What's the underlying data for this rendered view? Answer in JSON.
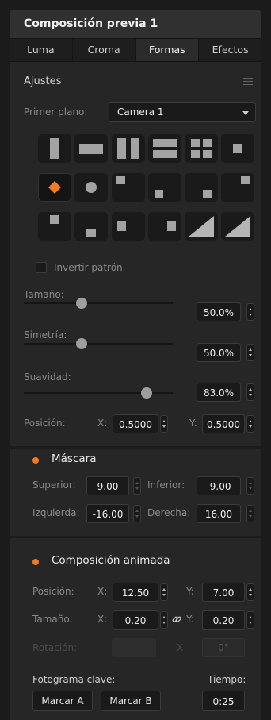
{
  "panel_title": "Composición previa 1",
  "tabs": [
    {
      "label": "Luma"
    },
    {
      "label": "Croma"
    },
    {
      "label": "Formas"
    },
    {
      "label": "Efectos"
    }
  ],
  "active_tab": "Formas",
  "settings": {
    "title": "Ajustes",
    "foreground_label": "Primer plano:",
    "foreground_value": "Camera 1",
    "invert_label": "Invertir patrón",
    "invert_checked": false,
    "size_label": "Tamaño:",
    "size_value": "50.0%",
    "size_level": 0.5,
    "symmetry_label": "Simetría:",
    "symmetry_value": "50.0%",
    "symmetry_level": 0.5,
    "softness_label": "Suavidad:",
    "softness_value": "83.0%",
    "softness_level": 0.83,
    "position_label": "Posición:",
    "pos_x_label": "X:",
    "pos_x_value": "0.5000",
    "pos_y_label": "Y:",
    "pos_y_value": "0.5000"
  },
  "shape_buttons": [
    "vertical-bar-icon",
    "horizontal-bar-icon",
    "vertical-split-icon",
    "horizontal-split-icon",
    "quad-split-icon",
    "box-icon",
    "diamond-icon",
    "circle-icon",
    "box-top-left-icon",
    "box-bottom-left-icon",
    "box-bottom-right-icon",
    "box-top-right-icon",
    "box-top-center-icon",
    "box-bottom-center-icon",
    "box-center-left-icon",
    "box-center-right-icon",
    "diagonal-wipe-left-icon",
    "diagonal-wipe-right-icon"
  ],
  "selected_shape": "diamond-icon",
  "mask": {
    "title": "Máscara",
    "top_label": "Superior:",
    "top_value": "9.00",
    "bottom_label": "Inferior:",
    "bottom_value": "-9.00",
    "left_label": "Izquierda:",
    "left_value": "-16.00",
    "right_label": "Derecha:",
    "right_value": "16.00"
  },
  "fly_key": {
    "title": "Composición animada",
    "position_label": "Posición:",
    "x_label": "X:",
    "pos_x_value": "12.50",
    "y_label": "Y:",
    "pos_y_value": "7.00",
    "size_label": "Tamaño:",
    "size_x_value": "0.20",
    "size_y_value": "0.20",
    "rotation_label": "Rotación:",
    "rotation_x_label": "X",
    "rotation_value": "0°",
    "keyframe_label": "Fotograma clave:",
    "set_a_label": "Marcar A",
    "set_b_label": "Marcar B",
    "time_label": "Tiempo:",
    "time_value": "0:25"
  },
  "colors": {
    "accent": "#f37a1f",
    "panel": "#262626",
    "field": "#1a1a1a"
  }
}
